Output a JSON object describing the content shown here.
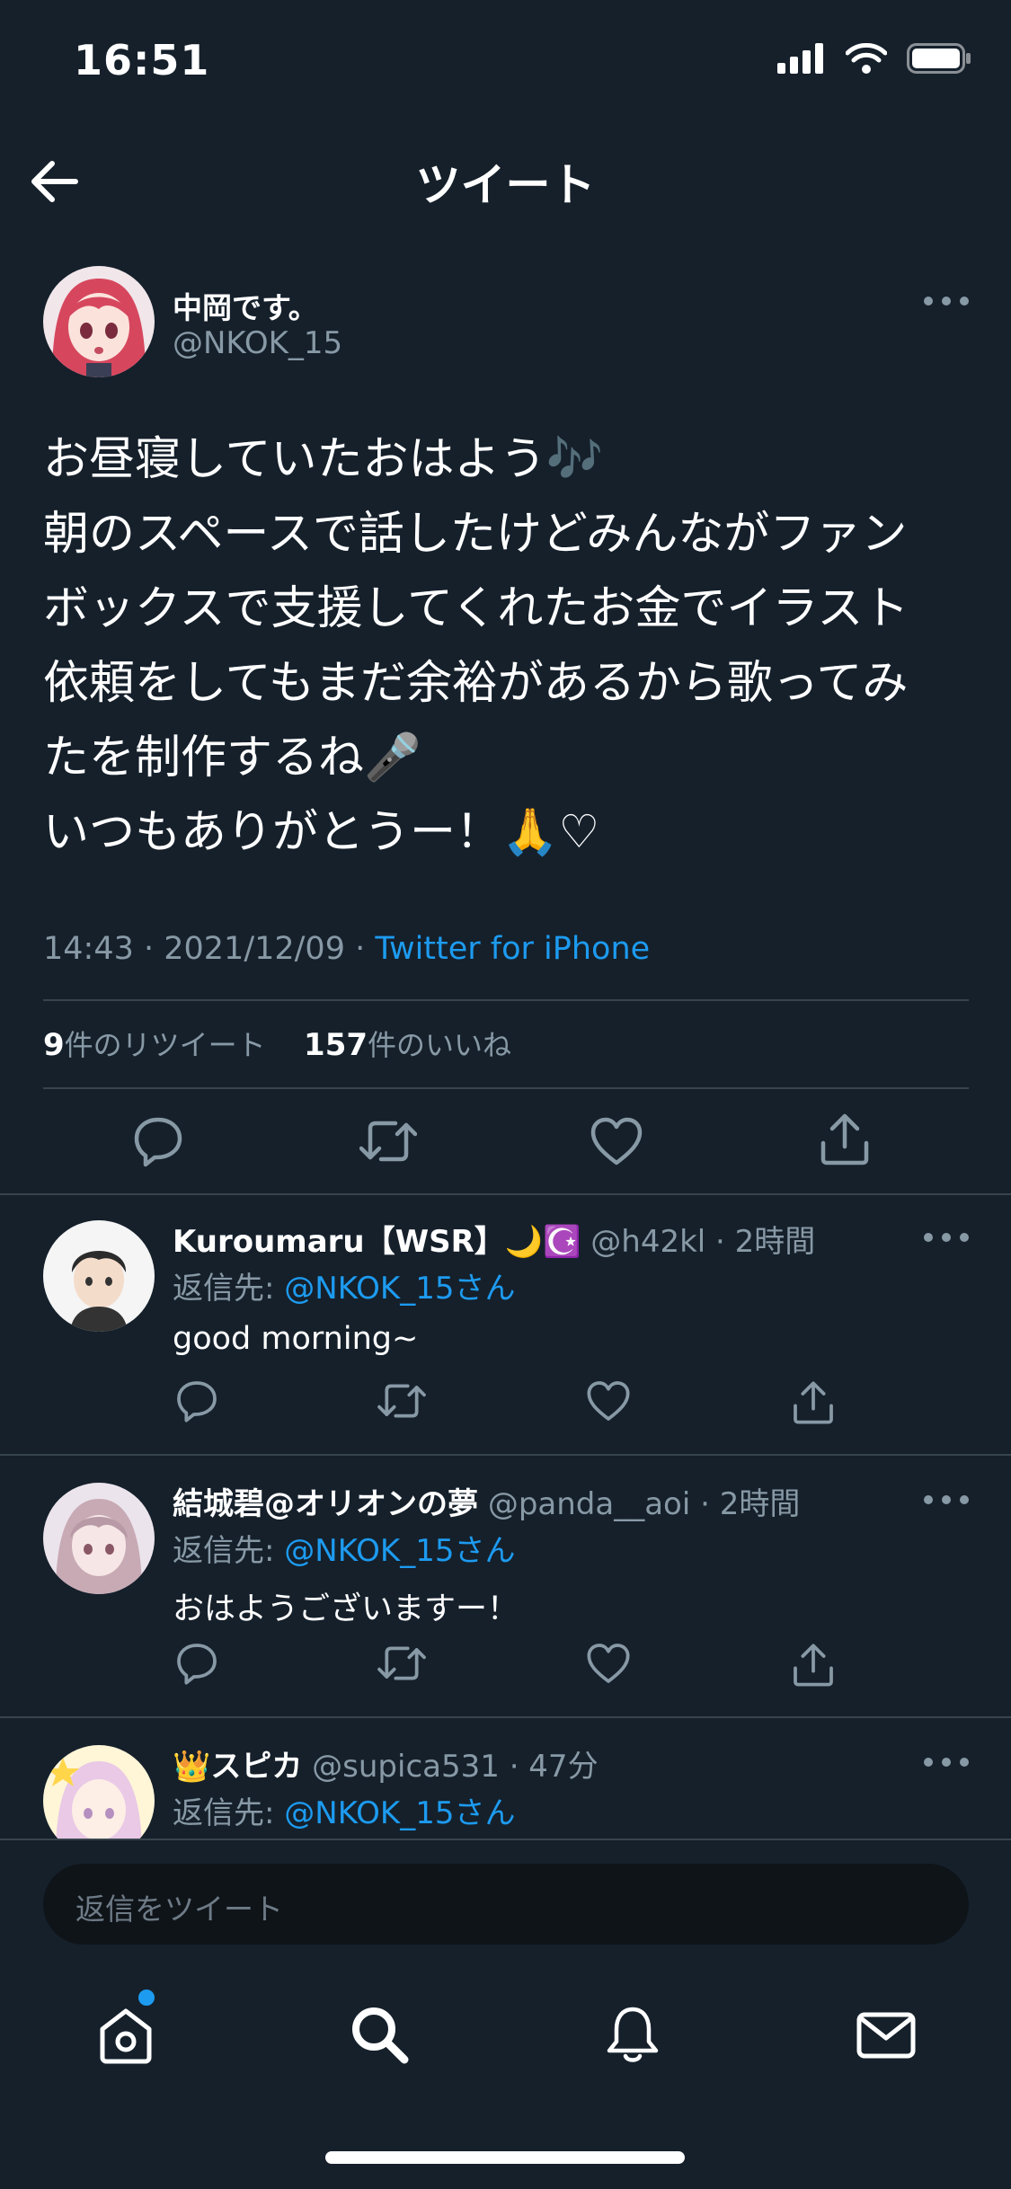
{
  "status": {
    "time": "16:51"
  },
  "header": {
    "title": "ツイート"
  },
  "tweet": {
    "name": "中岡です。",
    "handle": "@NKOK_15",
    "text": "お昼寝していたおはよう🎶\n朝のスペースで話したけどみんながファン\nボックスで支援してくれたお金でイラスト\n依頼をしてもまだ余裕があるから歌ってみ\nたを制作するね🎤\nいつもありがとうー！🙏♡",
    "time": "14:43 · 2021/12/09 · ",
    "source": "Twitter for iPhone",
    "retweet_count": "9",
    "retweet_label": "件のリツイート",
    "like_count": "157",
    "like_label": "件のいいね"
  },
  "replies": [
    {
      "name": "Kuroumaru【WSR】🌙☪️",
      "handle": "@h42kl",
      "time": "· 2時間",
      "reply_to_label": "返信先: ",
      "reply_to": "@NKOK_15さん",
      "text": "good morning~"
    },
    {
      "name": "結城碧@オリオンの夢",
      "handle": "@panda__aoi",
      "time": "· 2時間",
      "reply_to_label": "返信先: ",
      "reply_to": "@NKOK_15さん",
      "text": "おはようございますー！"
    },
    {
      "name": "👑スピカ",
      "handle": "@supica531",
      "time": "· 47分",
      "reply_to_label": "返信先: ",
      "reply_to": "@NKOK_15さん",
      "text": ""
    }
  ],
  "composer": {
    "placeholder": "返信をツイート"
  },
  "icons": {
    "back": "arrow-left-icon",
    "more": "more-dots-icon",
    "reply": "comment-icon",
    "retweet": "retweet-icon",
    "like": "heart-icon",
    "share": "share-icon",
    "tabs": [
      "home-icon",
      "search-icon",
      "bell-icon",
      "mail-icon"
    ]
  },
  "colors": {
    "background": "#15202b",
    "accent": "#1d9bf0",
    "muted": "#8899a6",
    "divider": "#38444d"
  }
}
